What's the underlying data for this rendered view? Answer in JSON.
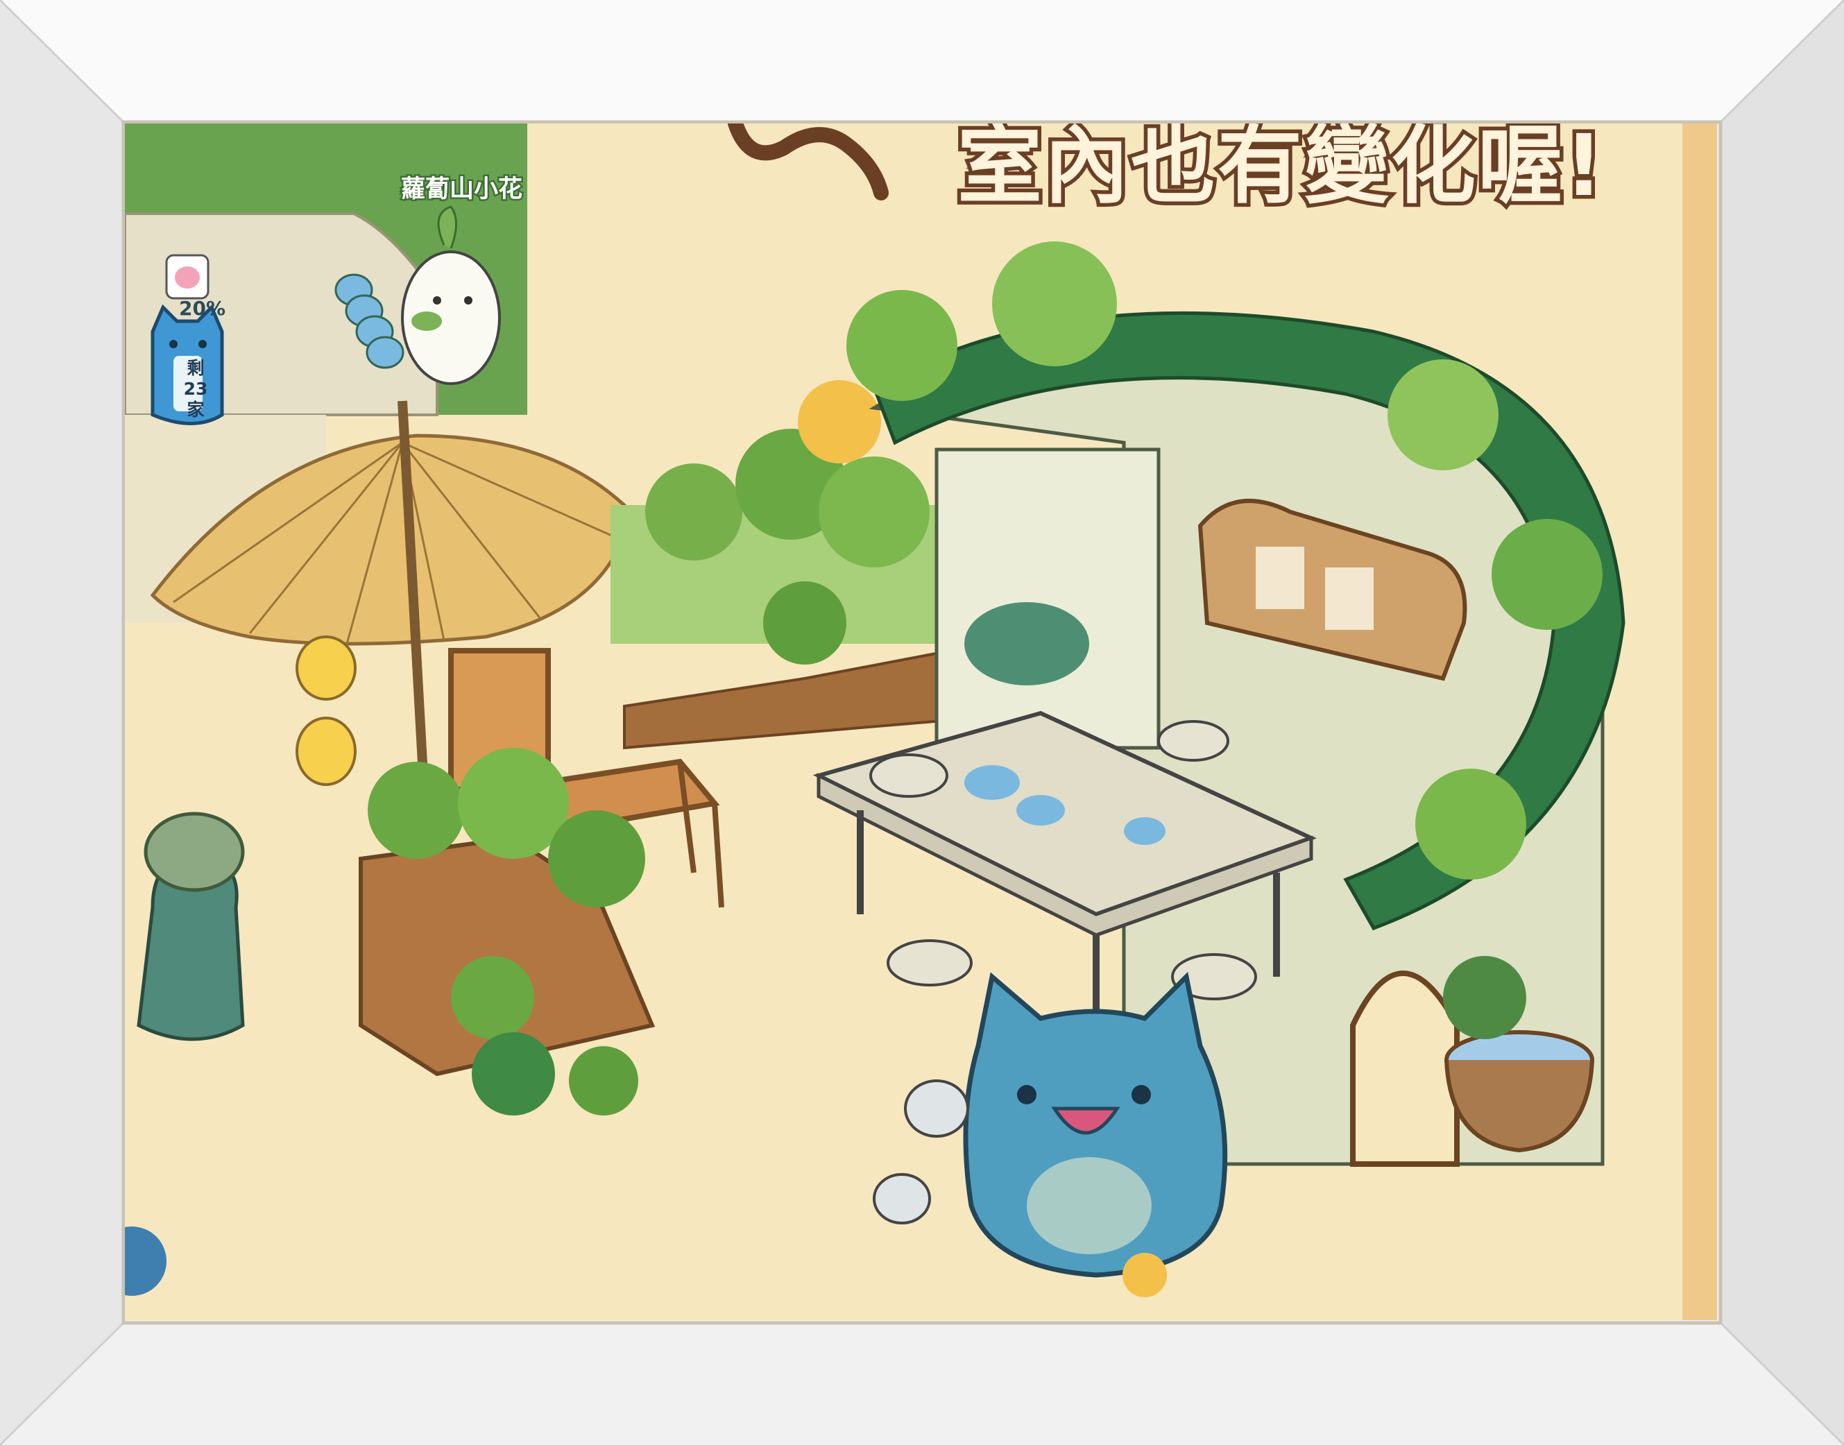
{
  "banner": {
    "title": "室內也有變化喔!"
  },
  "npc": {
    "name_label": "蘿蔔山小花"
  },
  "status": {
    "progress_percent": "20%",
    "remaining_line1": "剩",
    "remaining_count": "23",
    "remaining_line2": "家"
  },
  "colors": {
    "frame": "#f4f4f4",
    "canvas": "#f6e7bf",
    "foliage": "#6fa645",
    "cat_blue": "#4f9ec0",
    "title_outline": "#6b3f24"
  },
  "icons": [
    "photo-frame",
    "cat-character-icon",
    "radish-npc-icon",
    "umbrella-icon",
    "lantern-icon",
    "wooden-chair-icon",
    "stone-table-icon",
    "arch-door-icon",
    "plant-pot-icon"
  ]
}
